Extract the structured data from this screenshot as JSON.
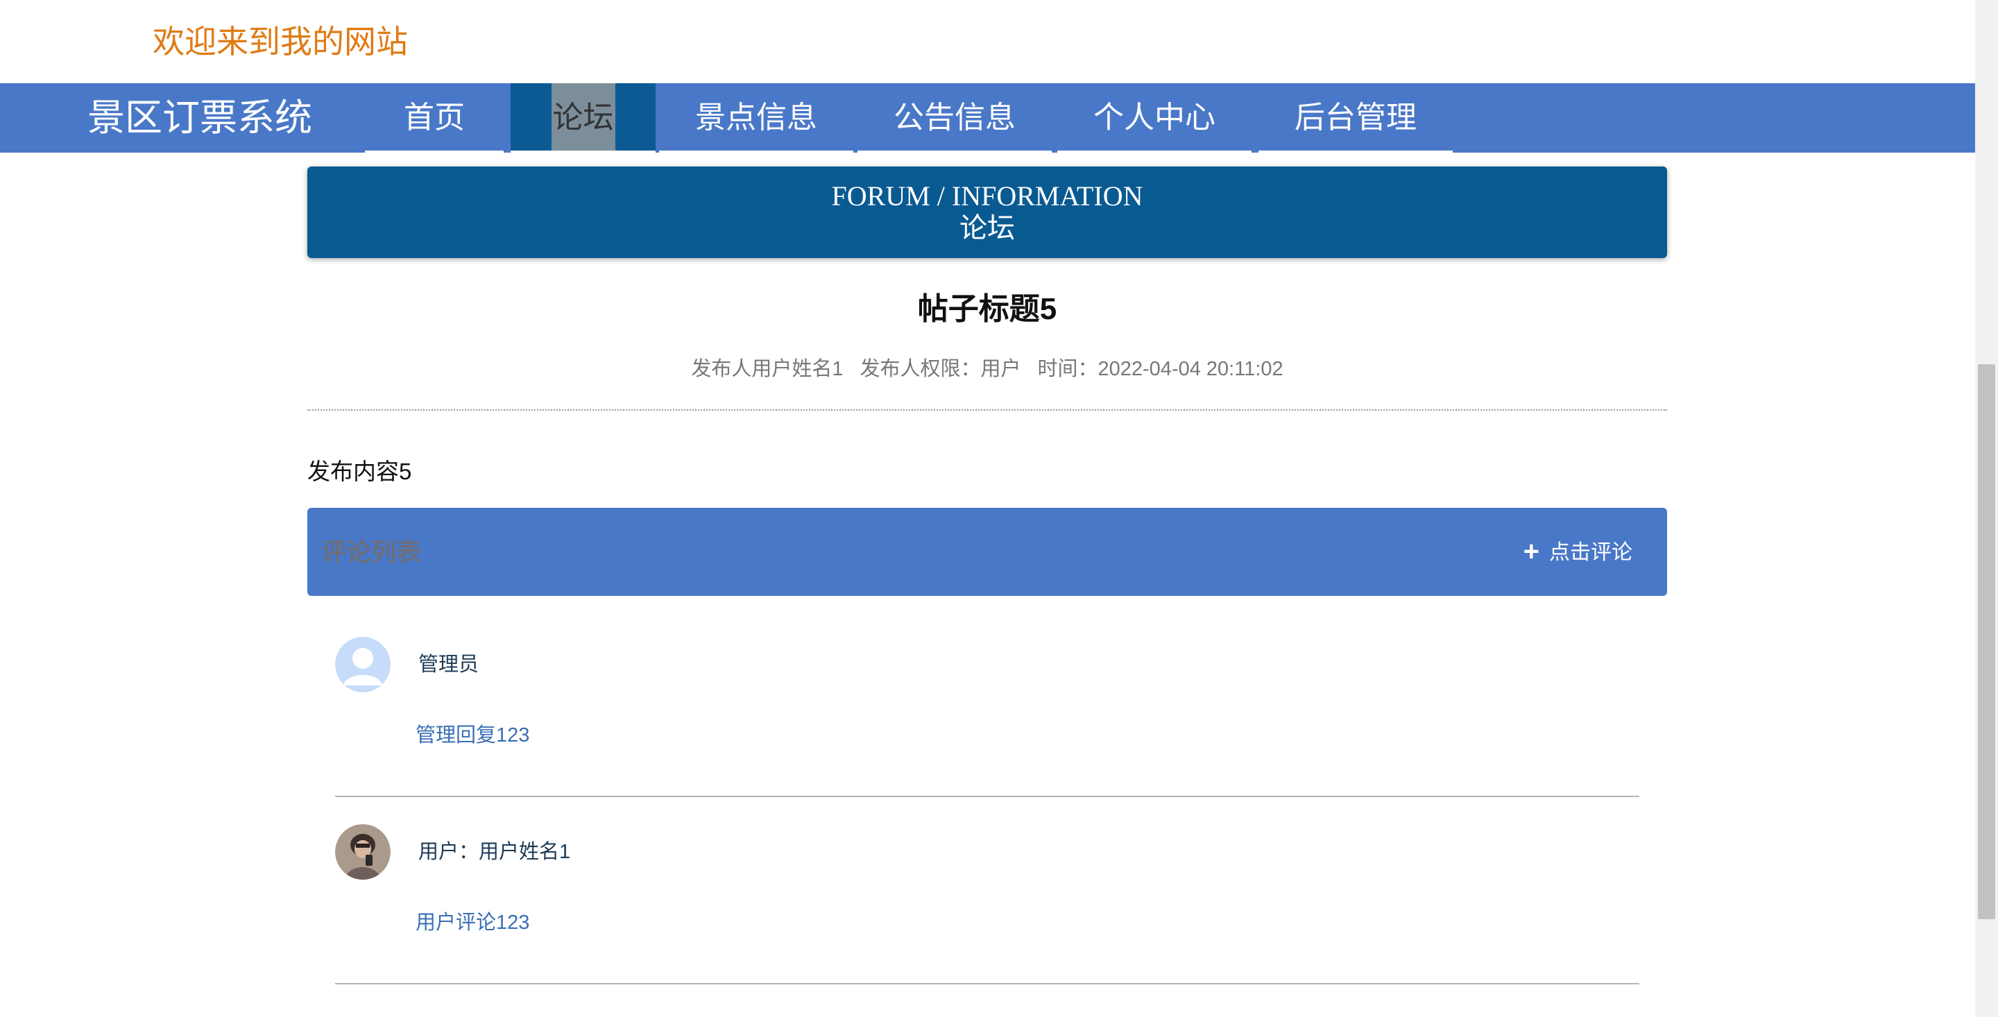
{
  "header": {
    "welcome": "欢迎来到我的网站"
  },
  "nav": {
    "brand": "景区订票系统",
    "items": [
      {
        "label": "首页"
      },
      {
        "label": "论坛"
      },
      {
        "label": "景点信息"
      },
      {
        "label": "公告信息"
      },
      {
        "label": "个人中心"
      },
      {
        "label": "后台管理"
      }
    ],
    "active": "论坛",
    "color": "#4a78c8",
    "active_color": "#0c5a94"
  },
  "banner": {
    "en": "FORUM / INFORMATION",
    "cn": "论坛",
    "color": "#0a5a92"
  },
  "post": {
    "title": "帖子标题5",
    "author": "发布人用户姓名1",
    "role": "发布人权限：用户",
    "time": "时间：2022-04-04 20:11:02",
    "content": "发布内容5"
  },
  "comments_header": {
    "title": "评论列表",
    "add_label": "点击评论",
    "add_icon": "plus-icon"
  },
  "comments": [
    {
      "name": "管理员",
      "text": "管理回复123",
      "avatar": "default-user-avatar"
    },
    {
      "name": "用户：用户姓名1",
      "text": "用户评论123",
      "avatar": "user-photo-avatar"
    }
  ]
}
